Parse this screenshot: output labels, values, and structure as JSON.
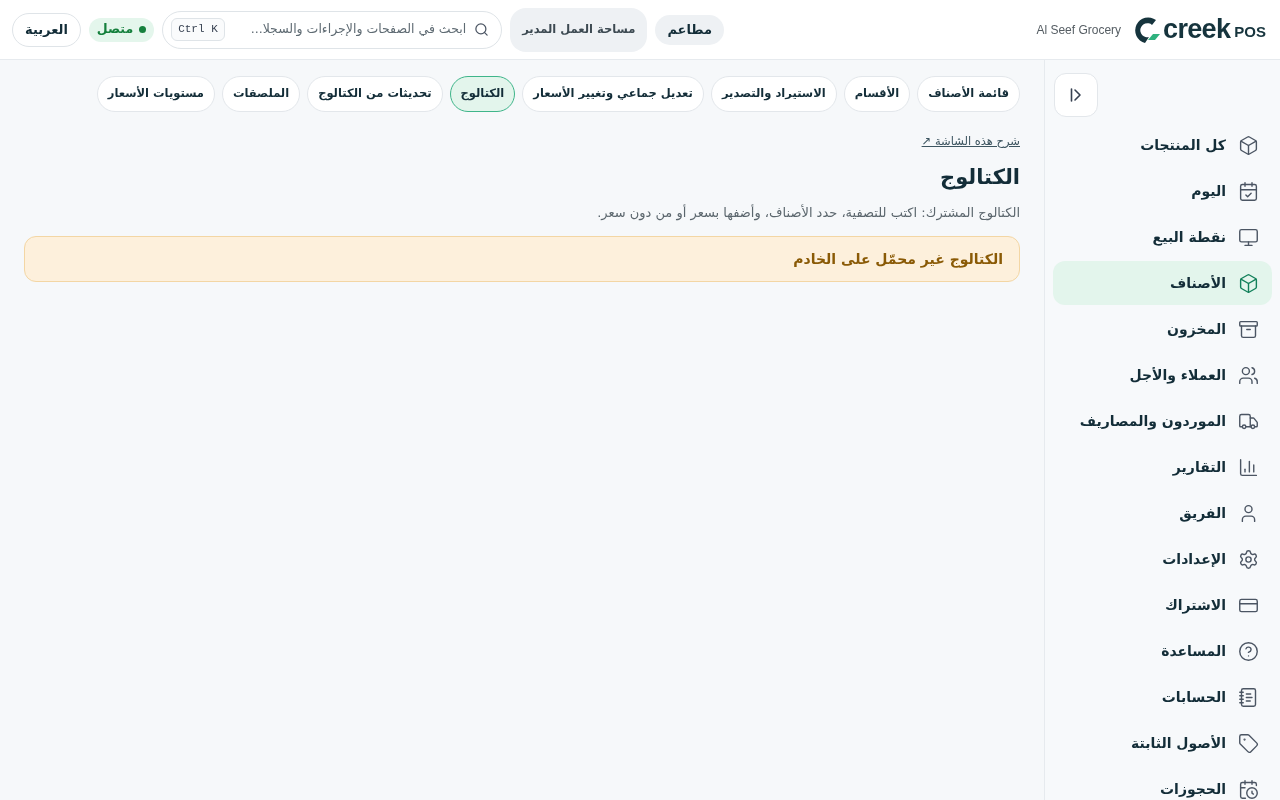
{
  "header": {
    "logo": {
      "wordmark": "creek",
      "suffix": "POS"
    },
    "store_name": "Al Seef Grocery",
    "business_type": {
      "label": "مطاعم"
    },
    "workspace": {
      "label": "مساحة العمل المدير"
    },
    "search": {
      "placeholder": "ابحث في الصفحات والإجراءات والسجلا...",
      "shortcut": "Ctrl K"
    },
    "connection": {
      "label": "متصل",
      "online": true
    },
    "language": {
      "label": "العربية"
    }
  },
  "sidebar": {
    "items": [
      {
        "label": "كل المنتجات",
        "selected": false
      },
      {
        "label": "اليوم",
        "selected": false
      },
      {
        "label": "نقطة البيع",
        "selected": false
      },
      {
        "label": "الأصناف",
        "selected": true
      },
      {
        "label": "المخزون",
        "selected": false
      },
      {
        "label": "العملاء والأجل",
        "selected": false
      },
      {
        "label": "الموردون والمصاريف",
        "selected": false
      },
      {
        "label": "التقارير",
        "selected": false
      },
      {
        "label": "الفريق",
        "selected": false
      },
      {
        "label": "الإعدادات",
        "selected": false
      },
      {
        "label": "الاشتراك",
        "selected": false
      },
      {
        "label": "المساعدة",
        "selected": false
      },
      {
        "label": "الحسابات",
        "selected": false
      },
      {
        "label": "الأصول الثابتة",
        "selected": false
      },
      {
        "label": "الحجوزات",
        "selected": false
      }
    ]
  },
  "tabs": [
    {
      "label": "قائمة الأصناف",
      "selected": false
    },
    {
      "label": "الأقسام",
      "selected": false
    },
    {
      "label": "الاستيراد والتصدير",
      "selected": false
    },
    {
      "label": "تعديل جماعي وتغيير الأسعار",
      "selected": false
    },
    {
      "label": "الكتالوج",
      "selected": true
    },
    {
      "label": "تحديثات من الكتالوج",
      "selected": false
    },
    {
      "label": "الملصقات",
      "selected": false
    },
    {
      "label": "مستويات الأسعار",
      "selected": false
    }
  ],
  "page": {
    "help_link": "شرح هذه الشاشة ↗",
    "title": "الكتالوج",
    "description": "الكتالوج المشترك: اكتب للتصفية، حدد الأصناف، وأضفها بسعر أو من دون سعر.",
    "alert": {
      "kind": "warning",
      "message": "الكتالوج غير محمّل على الخادم"
    }
  }
}
